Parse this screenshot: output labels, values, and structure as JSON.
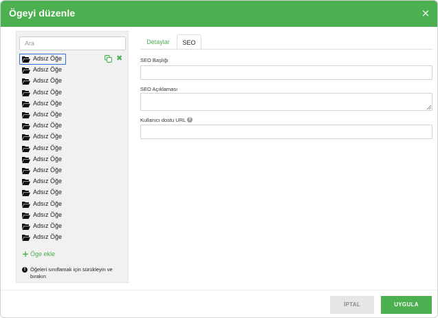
{
  "dialog": {
    "title": "Ögeyi düzenle",
    "close_glyph": "×"
  },
  "sidebar": {
    "search_placeholder": "Ara",
    "items": [
      {
        "label": "Adsız Öğe"
      },
      {
        "label": "Adsız Öğe"
      },
      {
        "label": "Adsız Öğe"
      },
      {
        "label": "Adsız Öğe"
      },
      {
        "label": "Adsız Öğe"
      },
      {
        "label": "Adsız Öğe"
      },
      {
        "label": "Adsız Öğe"
      },
      {
        "label": "Adsız Öğe"
      },
      {
        "label": "Adsız Öğe"
      },
      {
        "label": "Adsız Öğe"
      },
      {
        "label": "Adsız Öğe"
      },
      {
        "label": "Adsız Öğe"
      },
      {
        "label": "Adsız Öğe"
      },
      {
        "label": "Adsız Öğe"
      },
      {
        "label": "Adsız Öğe"
      },
      {
        "label": "Adsız Öğe"
      },
      {
        "label": "Adsız Öğe"
      }
    ],
    "selected_index": 0,
    "item_icon": "folder-open-icon",
    "add_label": "Öge ekle",
    "hint": "Öğeleri sınıflamak için sürükleyin ve bırakın"
  },
  "tabs": [
    {
      "label": "Detaylar",
      "active": false
    },
    {
      "label": "SEO",
      "active": true
    }
  ],
  "seo": {
    "title_label": "SEO Başlığı",
    "title_value": "",
    "description_label": "SEO Açıklaması",
    "description_value": "",
    "url_label": "Kullanıcı dostu URL",
    "url_value": "",
    "help_glyph": "?"
  },
  "buttons": {
    "cancel": "İPTAL",
    "apply": "UYGULA"
  },
  "colors": {
    "accent": "#4caf50",
    "selection": "#2f72d6",
    "panel_bg": "#f1f1f1"
  }
}
